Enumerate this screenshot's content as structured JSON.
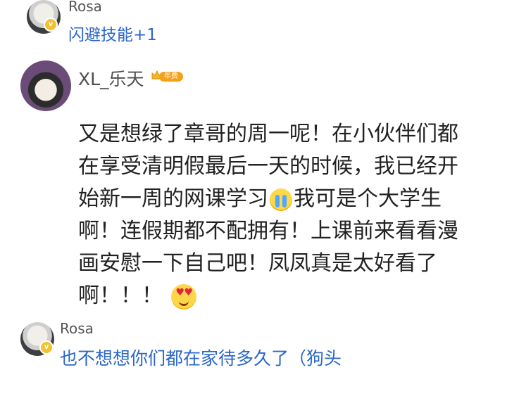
{
  "comments": [
    {
      "user": {
        "name": "Rosa",
        "badge_icon": "v-badge-icon"
      },
      "text": "闪避技能+1"
    },
    {
      "user": {
        "name": "XL_乐天",
        "badge_icon": "crown-annual-badge-icon",
        "badge_label": "年费"
      },
      "lines": [
        "又是想绿了章哥的周一呢！在小伙伴们都",
        "在享受清明假最后一天的时候，我已经开",
        "始新一周的网课学习",
        "我可是个大学生",
        "啊！连假期都不配拥有！上课前来看看漫",
        "画安慰一下自己吧！凤凤真是太好看了",
        "啊！！！"
      ],
      "emojis": [
        "crying-face-emoji",
        "heart-eyes-emoji"
      ]
    },
    {
      "user": {
        "name": "Rosa",
        "badge_icon": "v-badge-icon"
      },
      "text": "也不想想你们都在家待多久了（狗头"
    }
  ],
  "colors": {
    "reply_blue": "#2b67c9",
    "username_gray": "#555555",
    "body_text": "#222222",
    "badge_gold": "#f2c233"
  }
}
